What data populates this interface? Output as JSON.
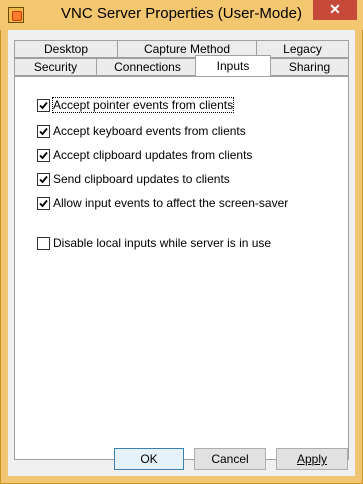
{
  "window": {
    "title": "VNC Server Properties (User-Mode)",
    "close_glyph": "✕"
  },
  "tabs": {
    "row1": [
      {
        "label": "Desktop"
      },
      {
        "label": "Capture Method"
      },
      {
        "label": "Legacy"
      }
    ],
    "row2": [
      {
        "label": "Security"
      },
      {
        "label": "Connections"
      },
      {
        "label": "Inputs",
        "active": true
      },
      {
        "label": "Sharing"
      }
    ]
  },
  "options": [
    {
      "label": "Accept pointer events from clients",
      "checked": true
    },
    {
      "label": "Accept keyboard events from clients",
      "checked": true
    },
    {
      "label": "Accept clipboard updates from clients",
      "checked": true
    },
    {
      "label": "Send clipboard updates to clients",
      "checked": true
    },
    {
      "label": "Allow input events to affect the screen-saver",
      "checked": true
    },
    {
      "label": "Disable local inputs while server is in use",
      "checked": false
    }
  ],
  "buttons": {
    "ok": "OK",
    "cancel": "Cancel",
    "apply": "Apply"
  },
  "colors": {
    "frame": "#f0c674",
    "close": "#c7493a",
    "default_button_border": "#3c7fb1"
  }
}
